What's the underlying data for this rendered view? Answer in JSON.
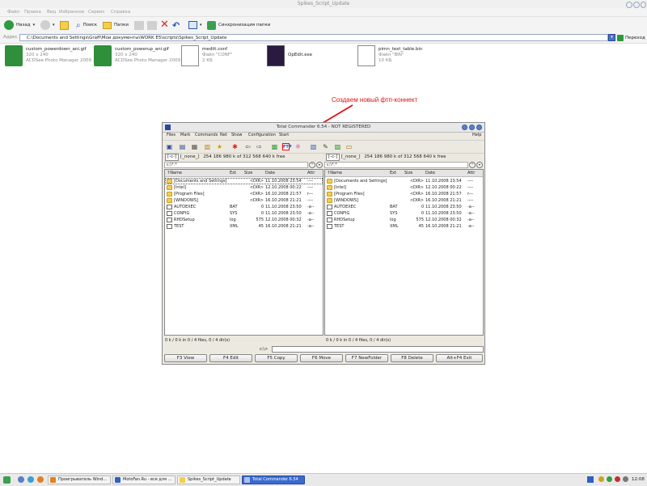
{
  "window": {
    "title": "Spikes_Script_Update",
    "menu": [
      "Файл",
      "Правка",
      "Вид",
      "Избранное",
      "Сервис",
      "Справка"
    ]
  },
  "toolbar": {
    "back_label": "Назад",
    "search_label": "Поиск",
    "folders_label": "Папки",
    "sync_label": "Синхронизация папки"
  },
  "address": {
    "label": "Адрес",
    "path": "C:\\Documents and Settings\\Graff\\Мои документы\\WORK E5\\scripts\\Spikes_Script_Update",
    "go_label": "Переход"
  },
  "files": [
    {
      "name": "custom_powerdown_ani.gif",
      "line2": "320 x 240",
      "line3": "ACDSee Photo Manager 2009 ..."
    },
    {
      "name": "custom_powerup_ani.gif",
      "line2": "320 x 240",
      "line3": "ACDSee Photo Manager 2009 ..."
    },
    {
      "name": "mediit.conf",
      "line2": "Файл \"CONF\"",
      "line3": "2 КБ"
    },
    {
      "name": "OpEdit.exe",
      "line2": "",
      "line3": ""
    },
    {
      "name": "pimn_text_table.bin",
      "line2": "Файл \"BIN\"",
      "line3": "10 КБ"
    }
  ],
  "annotation": "Создаем новый фтп-коннект",
  "tc": {
    "title": "Total Commander 6.54 - NOT REGISTERED",
    "menu": [
      "Files",
      "Mark",
      "Commands",
      "Net",
      "Show",
      "Configuration",
      "Start"
    ],
    "help": "Help",
    "ftp_icon_label": "FTP",
    "left": {
      "drive": "[-c-]",
      "volume": "[_none_]",
      "free": "254 186 980 k of 312 568 640 k free",
      "path": "c:\\*.*",
      "status": "0 k / 0 k in 0 / 4 files, 0 / 4 dir(s)"
    },
    "right": {
      "drive": "[-c-]",
      "volume": "[_none_]",
      "free": "254 186 980 k of 312 568 640 k free",
      "path": "c:\\*.*",
      "status": "0 k / 0 k in 0 / 4 files, 0 / 4 dir(s)"
    },
    "columns": {
      "name": "↑Name",
      "ext": "Ext",
      "size": "Size",
      "date": "Date",
      "attr": "Attr"
    },
    "rows": [
      {
        "name": "[Documents and Settings]",
        "ext": "",
        "size": "<DIR>",
        "date": "11.10.2008 23:54",
        "attr": "----",
        "type": "folder"
      },
      {
        "name": "[Intel]",
        "ext": "",
        "size": "<DIR>",
        "date": "12.10.2008 00:22",
        "attr": "----",
        "type": "folder"
      },
      {
        "name": "[Program Files]",
        "ext": "",
        "size": "<DIR>",
        "date": "16.10.2008 21:57",
        "attr": "r---",
        "type": "folder"
      },
      {
        "name": "[WINDOWS]",
        "ext": "",
        "size": "<DIR>",
        "date": "16.10.2008 21:21",
        "attr": "----",
        "type": "folder"
      },
      {
        "name": "AUTOEXEC",
        "ext": "BAT",
        "size": "0",
        "date": "11.10.2008 23:50",
        "attr": "-a--",
        "type": "file"
      },
      {
        "name": "CONFIG",
        "ext": "SYS",
        "size": "0",
        "date": "11.10.2008 23:50",
        "attr": "-a--",
        "type": "file"
      },
      {
        "name": "RHDSetup",
        "ext": "log",
        "size": "575",
        "date": "12.10.2008 00:32",
        "attr": "-a--",
        "type": "file"
      },
      {
        "name": "TEST",
        "ext": "XML",
        "size": "45",
        "date": "16.10.2008 21:21",
        "attr": "-a--",
        "type": "file"
      }
    ],
    "cmd_prompt": "c:\\>",
    "fkeys": [
      "F3 View",
      "F4 Edit",
      "F5 Copy",
      "F6 Move",
      "F7 NewFolder",
      "F8 Delete",
      "Alt+F4 Exit"
    ]
  },
  "taskbar": {
    "tasks": [
      "Проигрыватель Wind...",
      "MotoFan.Ru - все для ...",
      "Spikes_Script_Update",
      "Total Commander 6.54"
    ],
    "active_index": 3,
    "clock": "12:08"
  },
  "colors": {
    "accent": "#3a6ad0",
    "annotation": "#e01010",
    "ftp_highlight": "#ff0000"
  }
}
